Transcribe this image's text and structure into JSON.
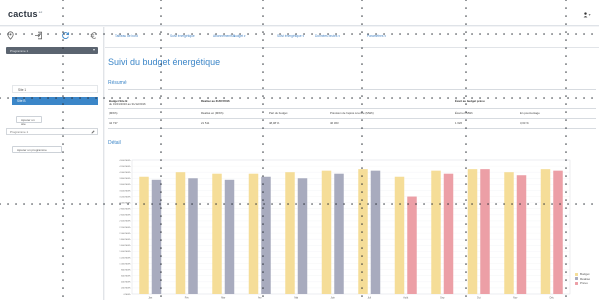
{
  "app": {
    "logo": "cactus",
    "logo_sup": "ec"
  },
  "colors": {
    "accent": "#3c86c8",
    "sidebar_select": "#5b6470",
    "active_site": "#3b86c8",
    "budget": "#f5dd98",
    "realise": "#a8abbe",
    "prevu": "#ec9fa6"
  },
  "toolbar": {
    "icons": [
      "map-pin-icon",
      "login-icon",
      "refresh-icon",
      "euro-icon"
    ]
  },
  "sidebar": {
    "select_label": "Programme 1",
    "sites": [
      {
        "label": "Site 1"
      },
      {
        "label": "Site B"
      }
    ],
    "add_site_label": "Ajouter un site",
    "programme_placeholder": "Programme 1",
    "add_programme_label": "Ajouter un programme"
  },
  "tabs": [
    {
      "label": "Tableau de bord"
    },
    {
      "label": "Suivi énergétique"
    },
    {
      "label": "Abonnements ▾"
    },
    {
      "label": "Budget ▾"
    },
    {
      "label": "Suivi énergétique ▾"
    },
    {
      "label": "Données brutes ▾"
    },
    {
      "label": "Paramètres ▾"
    }
  ],
  "page": {
    "title": "Suivi du budget énergétique",
    "resume_title": "Résumé",
    "detail_title": "Détail"
  },
  "summary": {
    "row1": [
      "Budget Site B",
      "Réalisé au 31/07/2016",
      "Écart au budget prévu"
    ],
    "row1_sub": "du 01/01/2016 au 31/12/2016",
    "row2": [
      "(MWh)",
      "Réalisé en (MWh)",
      "Part du budget",
      "Prévision de l'après à terme (MWh)",
      "Écart en MWh",
      "En pourcentage"
    ],
    "row3": [
      "44 737",
      "21 511",
      "48,08 %",
      "46 363",
      "1 626",
      "3,63 %"
    ]
  },
  "chart_data": {
    "type": "bar",
    "categories": [
      "Jan",
      "Fév",
      "Mar",
      "Avr",
      "Mai",
      "Juin",
      "Juil",
      "Août",
      "Sep",
      "Oct",
      "Nov",
      "Déc"
    ],
    "ylim": [
      0,
      4400
    ],
    "yticks": [
      "0 MWh",
      "200 MWh",
      "400 MWh",
      "600 MWh",
      "800 MWh",
      "1 000 MWh",
      "1 200 MWh",
      "1 400 MWh",
      "1 600 MWh",
      "1 800 MWh",
      "2 000 MWh",
      "2 200 MWh",
      "2 400 MWh",
      "2 600 MWh",
      "2 800 MWh",
      "3 000 MWh",
      "3 200 MWh",
      "3 400 MWh",
      "3 600 MWh",
      "3 800 MWh",
      "4 000 MWh",
      "4 200 MWh",
      "4 400 MWh"
    ],
    "series": [
      {
        "name": "Budget",
        "color": "#f5dd98",
        "values": [
          3850,
          4000,
          3950,
          3950,
          4000,
          4050,
          4100,
          3850,
          4050,
          4100,
          4000,
          4100
        ]
      },
      {
        "name": "Réalisé",
        "color": "#a8abbe",
        "values": [
          3750,
          3800,
          3750,
          3850,
          3800,
          3950,
          4050,
          null,
          null,
          null,
          null,
          null
        ]
      },
      {
        "name": "Prévu",
        "color": "#ec9fa6",
        "values": [
          null,
          null,
          null,
          null,
          null,
          null,
          null,
          3200,
          3950,
          4100,
          3900,
          4050
        ]
      }
    ],
    "grid": true,
    "legend": "right"
  }
}
